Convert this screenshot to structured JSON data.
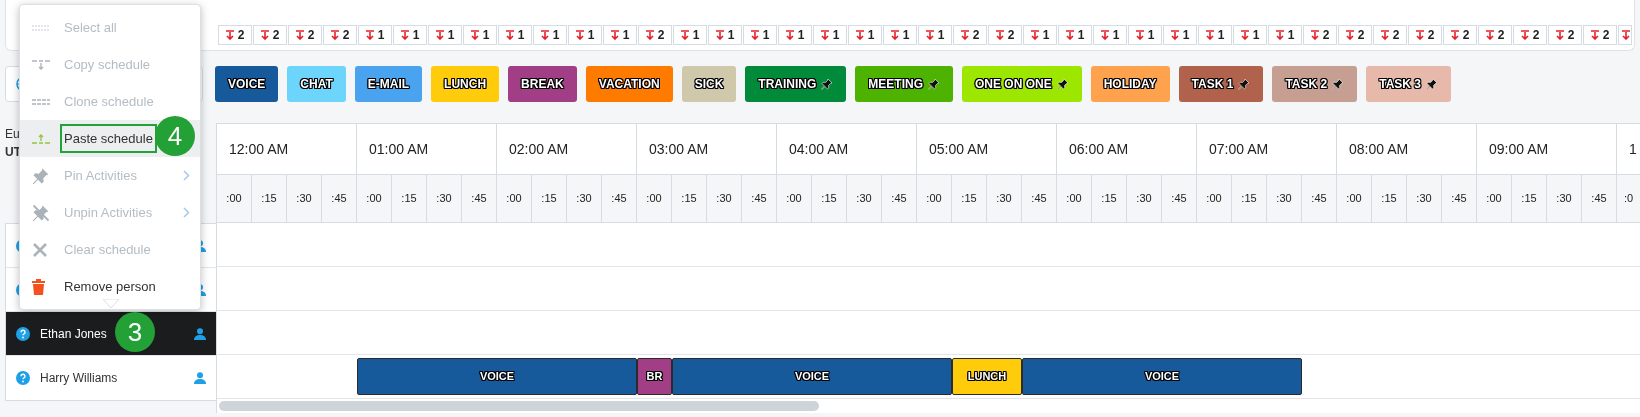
{
  "requirements": [
    "2",
    "2",
    "2",
    "2",
    "1",
    "1",
    "1",
    "1",
    "1",
    "1",
    "1",
    "1",
    "2",
    "1",
    "1",
    "1",
    "1",
    "1",
    "1",
    "1",
    "1",
    "2",
    "2",
    "1",
    "1",
    "1",
    "1",
    "1",
    "1",
    "1",
    "1",
    "2",
    "2",
    "2",
    "2",
    "2",
    "2",
    "2",
    "2",
    "2"
  ],
  "activities": [
    {
      "label": "VOICE",
      "color": "#175a9c",
      "pinned": false
    },
    {
      "label": "CHAT",
      "color": "#6dd5fc",
      "pinned": false
    },
    {
      "label": "E-MAIL",
      "color": "#4aa3ee",
      "pinned": false
    },
    {
      "label": "LUNCH",
      "color": "#fecc0a",
      "pinned": false
    },
    {
      "label": "BREAK",
      "color": "#a23e86",
      "pinned": false
    },
    {
      "label": "VACATION",
      "color": "#ff7b00",
      "pinned": false
    },
    {
      "label": "SICK",
      "color": "#cfc8ab",
      "pinned": false
    },
    {
      "label": "TRAINING",
      "color": "#008a3a",
      "pinned": true
    },
    {
      "label": "MEETING",
      "color": "#4eb300",
      "pinned": true
    },
    {
      "label": "ONE ON ONE",
      "color": "#9de600",
      "pinned": true
    },
    {
      "label": "HOLIDAY",
      "color": "#fea24e",
      "pinned": false
    },
    {
      "label": "TASK 1",
      "color": "#b0624c",
      "pinned": true
    },
    {
      "label": "TASK 2",
      "color": "#c69e92",
      "pinned": true
    },
    {
      "label": "TASK 3",
      "color": "#e7b9ab",
      "pinned": true
    }
  ],
  "timezone": {
    "line_1": "Eu",
    "line_2": "UT"
  },
  "hours": [
    {
      "label": "12:00 AM",
      "quarters": [
        ":00",
        ":15",
        ":30",
        ":45"
      ]
    },
    {
      "label": "01:00 AM",
      "quarters": [
        ":00",
        ":15",
        ":30",
        ":45"
      ]
    },
    {
      "label": "02:00 AM",
      "quarters": [
        ":00",
        ":15",
        ":30",
        ":45"
      ]
    },
    {
      "label": "03:00 AM",
      "quarters": [
        ":00",
        ":15",
        ":30",
        ":45"
      ]
    },
    {
      "label": "04:00 AM",
      "quarters": [
        ":00",
        ":15",
        ":30",
        ":45"
      ]
    },
    {
      "label": "05:00 AM",
      "quarters": [
        ":00",
        ":15",
        ":30",
        ":45"
      ]
    },
    {
      "label": "06:00 AM",
      "quarters": [
        ":00",
        ":15",
        ":30",
        ":45"
      ]
    },
    {
      "label": "07:00 AM",
      "quarters": [
        ":00",
        ":15",
        ":30",
        ":45"
      ]
    },
    {
      "label": "08:00 AM",
      "quarters": [
        ":00",
        ":15",
        ":30",
        ":45"
      ]
    },
    {
      "label": "09:00 AM",
      "quarters": [
        ":00",
        ":15",
        ":30",
        ":45"
      ]
    },
    {
      "label": "1",
      "quarters": [
        ":0"
      ]
    }
  ],
  "people": [
    {
      "selected": false
    },
    {
      "selected": false
    },
    {
      "name": "Ethan Jones",
      "selected": true
    },
    {
      "name": "Harry Williams",
      "selected": false,
      "shifts": [
        {
          "label": "VOICE",
          "color": "#175a9c"
        },
        {
          "label": "BR",
          "color": "#a23e86"
        },
        {
          "label": "VOICE",
          "color": "#175a9c"
        },
        {
          "label": "LUNCH",
          "color": "#fecc0a"
        },
        {
          "label": "VOICE",
          "color": "#175a9c"
        }
      ]
    }
  ],
  "context_menu": [
    {
      "label": "Select all",
      "disabled": true,
      "highlighted": false,
      "submenu": false
    },
    {
      "label": "Copy schedule",
      "disabled": true,
      "highlighted": false,
      "submenu": false
    },
    {
      "label": "Clone schedule",
      "disabled": true,
      "highlighted": false,
      "submenu": false
    },
    {
      "label": "Paste schedule",
      "disabled": false,
      "highlighted": true,
      "submenu": false
    },
    {
      "label": "Pin Activities",
      "disabled": true,
      "highlighted": false,
      "submenu": true
    },
    {
      "label": "Unpin Activities",
      "disabled": true,
      "highlighted": false,
      "submenu": true
    },
    {
      "label": "Clear schedule",
      "disabled": true,
      "highlighted": false,
      "submenu": false
    },
    {
      "label": "Remove person",
      "disabled": false,
      "highlighted": false,
      "submenu": false
    }
  ],
  "step_badges": [
    "4",
    "3"
  ]
}
